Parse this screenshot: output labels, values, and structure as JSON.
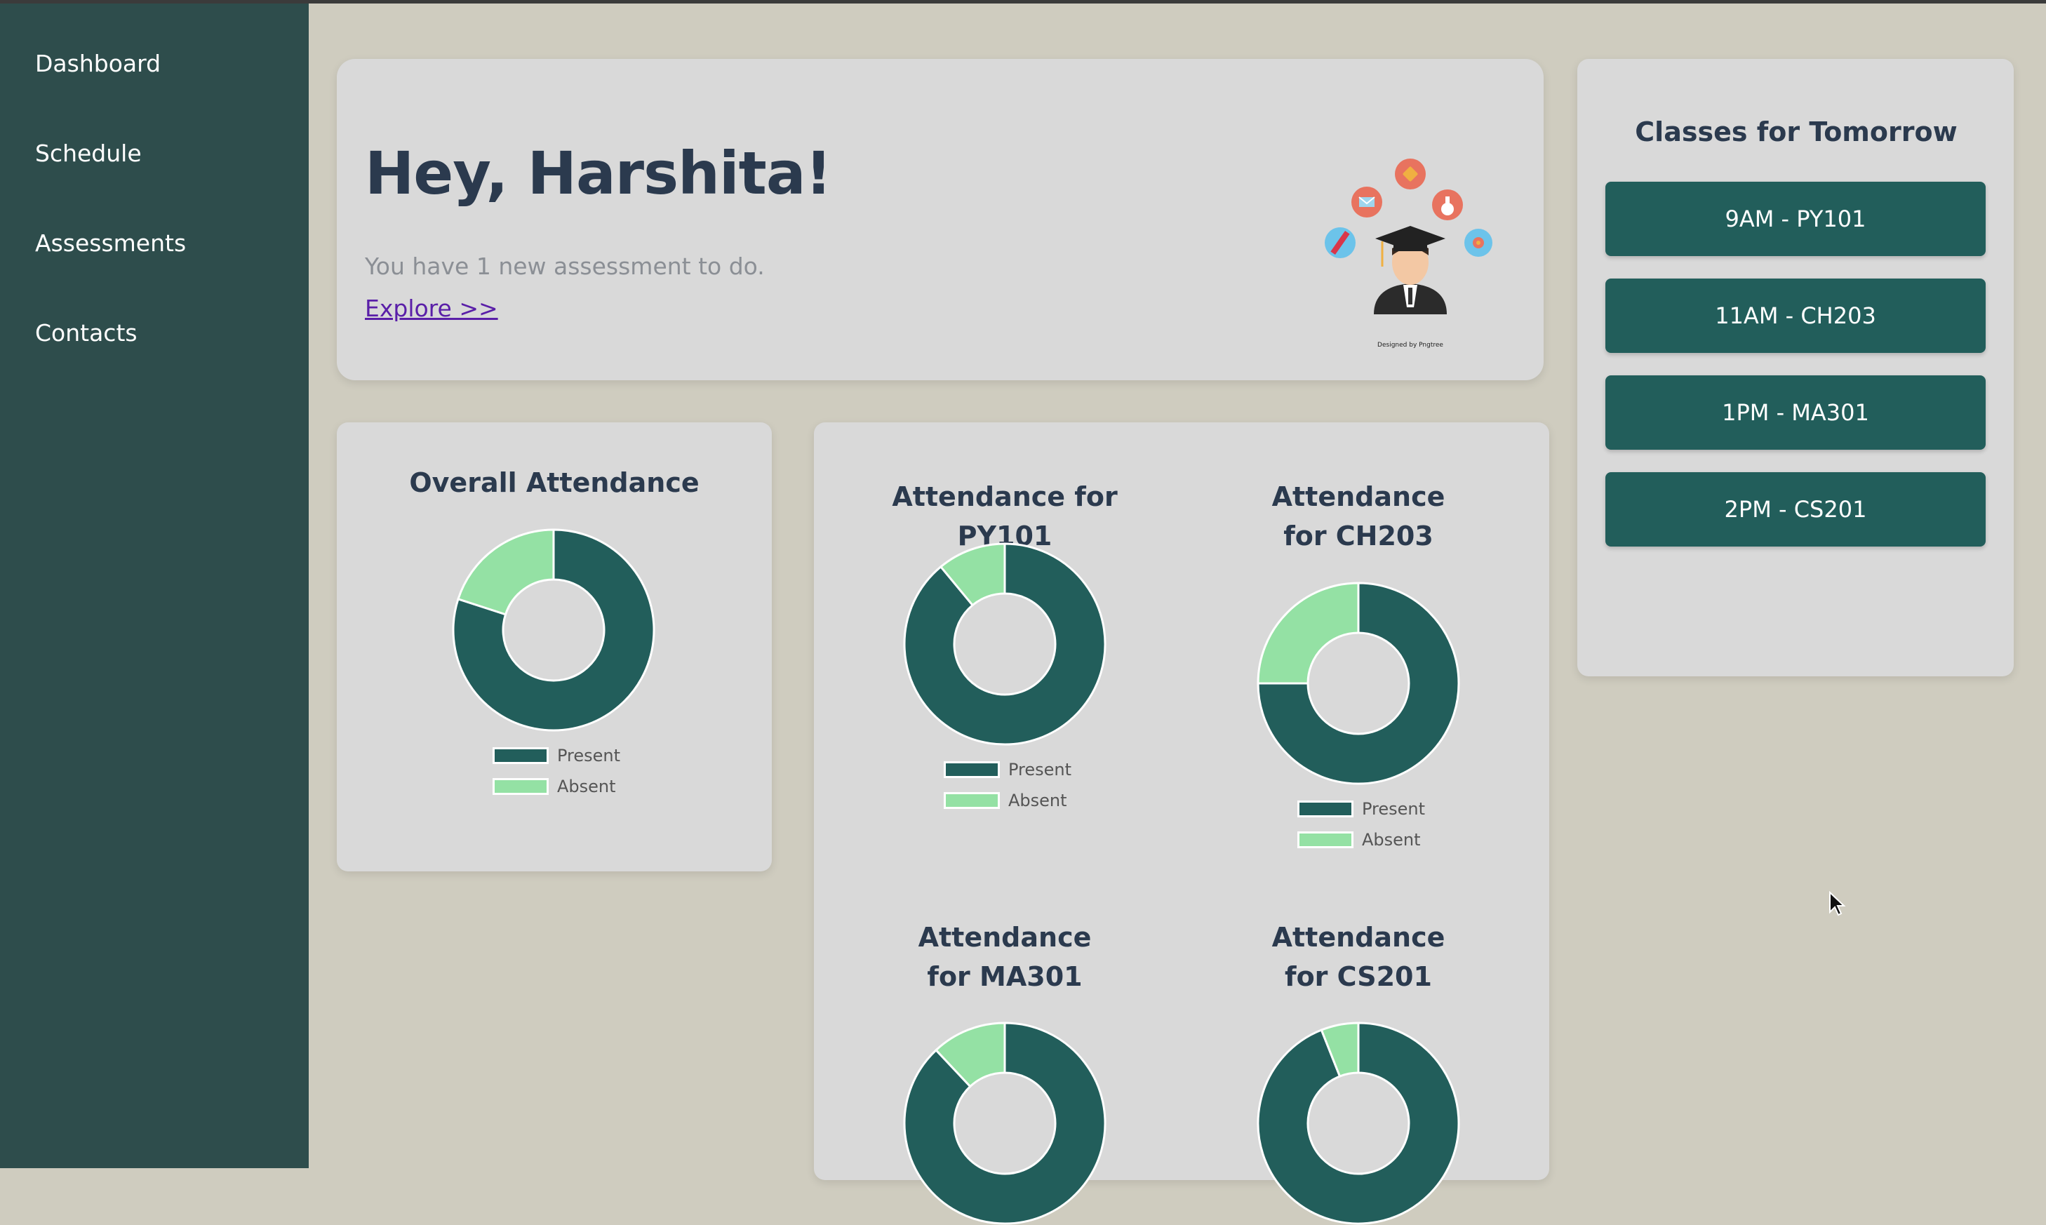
{
  "sidebar": {
    "items": [
      {
        "label": "Dashboard"
      },
      {
        "label": "Schedule"
      },
      {
        "label": "Assessments"
      },
      {
        "label": "Contacts"
      }
    ]
  },
  "welcome": {
    "greeting": "Hey, Harshita!",
    "message": "You have 1 new assessment to do.",
    "link": "Explore >>",
    "illustration_credit": "Designed by Pngtree"
  },
  "classes": {
    "title": "Classes for Tomorrow",
    "items": [
      "9AM - PY101",
      "11AM - CH203",
      "1PM - MA301",
      "2PM - CS201"
    ]
  },
  "colors": {
    "present": "#225e5b",
    "absent": "#94e1a4",
    "sidebar": "#2e4d4c",
    "background": "#cfccbf"
  },
  "legend": {
    "present": "Present",
    "absent": "Absent"
  },
  "chart_data": [
    {
      "type": "pie",
      "title": "Overall Attendance",
      "categories": [
        "Present",
        "Absent"
      ],
      "values": [
        80,
        20
      ]
    },
    {
      "type": "pie",
      "title": "Attendance for PY101",
      "categories": [
        "Present",
        "Absent"
      ],
      "values": [
        89,
        11
      ]
    },
    {
      "type": "pie",
      "title": "Attendance for CH203",
      "categories": [
        "Present",
        "Absent"
      ],
      "values": [
        75,
        25
      ]
    },
    {
      "type": "pie",
      "title": "Attendance for MA301",
      "categories": [
        "Present",
        "Absent"
      ],
      "values": [
        88,
        12
      ]
    },
    {
      "type": "pie",
      "title": "Attendance for CS201",
      "categories": [
        "Present",
        "Absent"
      ],
      "values": [
        94,
        6
      ]
    }
  ]
}
